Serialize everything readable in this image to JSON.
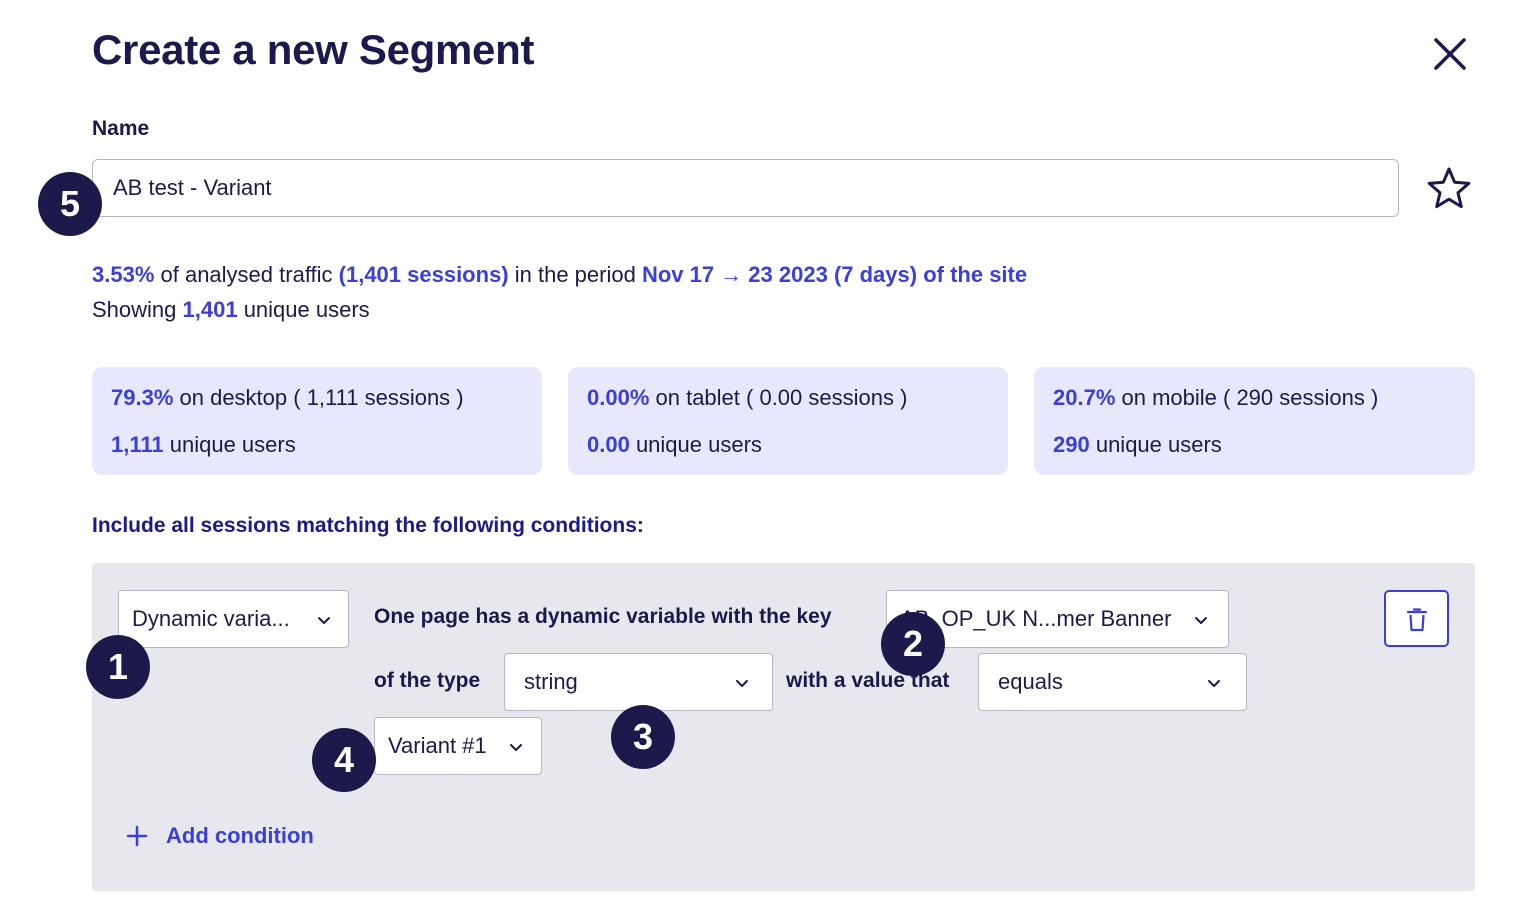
{
  "header": {
    "title": "Create a new Segment",
    "close_icon": "close-icon"
  },
  "name_field": {
    "label": "Name",
    "value": "AB test - Variant",
    "favorite_icon": "star-outline-icon"
  },
  "summary": {
    "pct": "3.53%",
    "text1": " of analysed traffic ",
    "sessions": "(1,401 sessions)",
    "text2": " in the period ",
    "period": "Nov 17 → 23 2023 (7 days) of the site",
    "showing": "Showing ",
    "unique_count": "1,401",
    "unique_text": " unique users"
  },
  "devices": [
    {
      "pct": "79.3%",
      "line1_text": " on desktop ( 1,111 sessions )",
      "users": "1,111",
      "users_text": " unique users"
    },
    {
      "pct": "0.00%",
      "line1_text": " on tablet ( 0.00 sessions )",
      "users": "0.00",
      "users_text": " unique users"
    },
    {
      "pct": "20.7%",
      "line1_text": " on mobile ( 290 sessions )",
      "users": "290",
      "users_text": " unique users"
    }
  ],
  "conditions": {
    "title": "Include all sessions matching the following conditions:",
    "condition_type": "Dynamic varia...",
    "key_text": "One page has a dynamic variable with the key",
    "key_value": "AB_OP_UK N...mer Banner",
    "type_text": "of the type",
    "type_value": "string",
    "operator_text": "with a value that",
    "operator_value": "equals",
    "value": "Variant #1",
    "delete_icon": "trash-icon",
    "add_label": "Add condition",
    "add_icon": "plus-icon"
  },
  "badges": [
    "1",
    "2",
    "3",
    "4",
    "5"
  ],
  "colors": {
    "accent": "#3b3fd8",
    "text_dark": "#1c1a4d",
    "card_bg": "#e7e8fb",
    "panel_bg": "#e6e8ed",
    "badge_bg": "#1b1a4a"
  }
}
